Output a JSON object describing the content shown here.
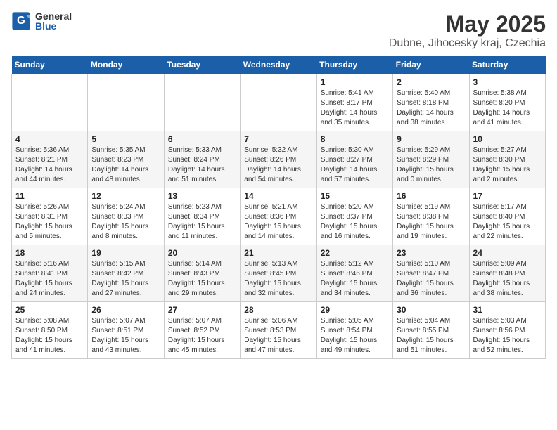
{
  "logo": {
    "general": "General",
    "blue": "Blue"
  },
  "title": "May 2025",
  "subtitle": "Dubne, Jihocesky kraj, Czechia",
  "headers": [
    "Sunday",
    "Monday",
    "Tuesday",
    "Wednesday",
    "Thursday",
    "Friday",
    "Saturday"
  ],
  "weeks": [
    [
      {
        "day": "",
        "info": ""
      },
      {
        "day": "",
        "info": ""
      },
      {
        "day": "",
        "info": ""
      },
      {
        "day": "",
        "info": ""
      },
      {
        "day": "1",
        "info": "Sunrise: 5:41 AM\nSunset: 8:17 PM\nDaylight: 14 hours\nand 35 minutes."
      },
      {
        "day": "2",
        "info": "Sunrise: 5:40 AM\nSunset: 8:18 PM\nDaylight: 14 hours\nand 38 minutes."
      },
      {
        "day": "3",
        "info": "Sunrise: 5:38 AM\nSunset: 8:20 PM\nDaylight: 14 hours\nand 41 minutes."
      }
    ],
    [
      {
        "day": "4",
        "info": "Sunrise: 5:36 AM\nSunset: 8:21 PM\nDaylight: 14 hours\nand 44 minutes."
      },
      {
        "day": "5",
        "info": "Sunrise: 5:35 AM\nSunset: 8:23 PM\nDaylight: 14 hours\nand 48 minutes."
      },
      {
        "day": "6",
        "info": "Sunrise: 5:33 AM\nSunset: 8:24 PM\nDaylight: 14 hours\nand 51 minutes."
      },
      {
        "day": "7",
        "info": "Sunrise: 5:32 AM\nSunset: 8:26 PM\nDaylight: 14 hours\nand 54 minutes."
      },
      {
        "day": "8",
        "info": "Sunrise: 5:30 AM\nSunset: 8:27 PM\nDaylight: 14 hours\nand 57 minutes."
      },
      {
        "day": "9",
        "info": "Sunrise: 5:29 AM\nSunset: 8:29 PM\nDaylight: 15 hours\nand 0 minutes."
      },
      {
        "day": "10",
        "info": "Sunrise: 5:27 AM\nSunset: 8:30 PM\nDaylight: 15 hours\nand 2 minutes."
      }
    ],
    [
      {
        "day": "11",
        "info": "Sunrise: 5:26 AM\nSunset: 8:31 PM\nDaylight: 15 hours\nand 5 minutes."
      },
      {
        "day": "12",
        "info": "Sunrise: 5:24 AM\nSunset: 8:33 PM\nDaylight: 15 hours\nand 8 minutes."
      },
      {
        "day": "13",
        "info": "Sunrise: 5:23 AM\nSunset: 8:34 PM\nDaylight: 15 hours\nand 11 minutes."
      },
      {
        "day": "14",
        "info": "Sunrise: 5:21 AM\nSunset: 8:36 PM\nDaylight: 15 hours\nand 14 minutes."
      },
      {
        "day": "15",
        "info": "Sunrise: 5:20 AM\nSunset: 8:37 PM\nDaylight: 15 hours\nand 16 minutes."
      },
      {
        "day": "16",
        "info": "Sunrise: 5:19 AM\nSunset: 8:38 PM\nDaylight: 15 hours\nand 19 minutes."
      },
      {
        "day": "17",
        "info": "Sunrise: 5:17 AM\nSunset: 8:40 PM\nDaylight: 15 hours\nand 22 minutes."
      }
    ],
    [
      {
        "day": "18",
        "info": "Sunrise: 5:16 AM\nSunset: 8:41 PM\nDaylight: 15 hours\nand 24 minutes."
      },
      {
        "day": "19",
        "info": "Sunrise: 5:15 AM\nSunset: 8:42 PM\nDaylight: 15 hours\nand 27 minutes."
      },
      {
        "day": "20",
        "info": "Sunrise: 5:14 AM\nSunset: 8:43 PM\nDaylight: 15 hours\nand 29 minutes."
      },
      {
        "day": "21",
        "info": "Sunrise: 5:13 AM\nSunset: 8:45 PM\nDaylight: 15 hours\nand 32 minutes."
      },
      {
        "day": "22",
        "info": "Sunrise: 5:12 AM\nSunset: 8:46 PM\nDaylight: 15 hours\nand 34 minutes."
      },
      {
        "day": "23",
        "info": "Sunrise: 5:10 AM\nSunset: 8:47 PM\nDaylight: 15 hours\nand 36 minutes."
      },
      {
        "day": "24",
        "info": "Sunrise: 5:09 AM\nSunset: 8:48 PM\nDaylight: 15 hours\nand 38 minutes."
      }
    ],
    [
      {
        "day": "25",
        "info": "Sunrise: 5:08 AM\nSunset: 8:50 PM\nDaylight: 15 hours\nand 41 minutes."
      },
      {
        "day": "26",
        "info": "Sunrise: 5:07 AM\nSunset: 8:51 PM\nDaylight: 15 hours\nand 43 minutes."
      },
      {
        "day": "27",
        "info": "Sunrise: 5:07 AM\nSunset: 8:52 PM\nDaylight: 15 hours\nand 45 minutes."
      },
      {
        "day": "28",
        "info": "Sunrise: 5:06 AM\nSunset: 8:53 PM\nDaylight: 15 hours\nand 47 minutes."
      },
      {
        "day": "29",
        "info": "Sunrise: 5:05 AM\nSunset: 8:54 PM\nDaylight: 15 hours\nand 49 minutes."
      },
      {
        "day": "30",
        "info": "Sunrise: 5:04 AM\nSunset: 8:55 PM\nDaylight: 15 hours\nand 51 minutes."
      },
      {
        "day": "31",
        "info": "Sunrise: 5:03 AM\nSunset: 8:56 PM\nDaylight: 15 hours\nand 52 minutes."
      }
    ]
  ]
}
